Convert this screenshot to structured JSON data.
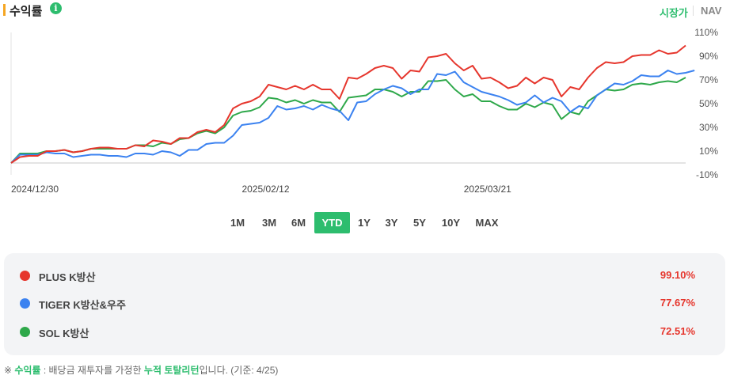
{
  "header": {
    "title": "수익률",
    "info_glyph": "i",
    "toggle_price": "시장가",
    "toggle_nav": "NAV"
  },
  "periods": [
    "1M",
    "3M",
    "6M",
    "YTD",
    "1Y",
    "3Y",
    "5Y",
    "10Y",
    "MAX"
  ],
  "active_period": "YTD",
  "legend": [
    {
      "name": "PLUS K방산",
      "value": "99.10%",
      "color": "#e6362d"
    },
    {
      "name": "TIGER K방산&우주",
      "value": "77.67%",
      "color": "#3b82f0"
    },
    {
      "name": "SOL K방산",
      "value": "72.51%",
      "color": "#2ea84a"
    }
  ],
  "footnote": {
    "prefix": "※ ",
    "term": "수익률",
    "mid": " : 배당금 재투자를 가정한 ",
    "emph": "누적 토탈리턴",
    "suffix": "입니다. (기준: 4/25)"
  },
  "colors": {
    "accent": "#2dbd6e",
    "title_bar": "#f5a623",
    "value_red": "#e6362d"
  },
  "chart_data": {
    "type": "line",
    "x_tick_labels": [
      "2024/12/30",
      "2025/02/12",
      "2025/03/21"
    ],
    "y_tick_labels": [
      "110%",
      "90%",
      "70%",
      "50%",
      "30%",
      "10%",
      "-10%"
    ],
    "ylim": [
      -10,
      110
    ],
    "grid": false,
    "legend_position": "bottom",
    "series": [
      {
        "name": "PLUS K방산",
        "color": "#e6362d",
        "values": [
          0,
          5,
          6,
          6,
          10,
          10,
          11,
          9,
          10,
          12,
          13,
          13,
          12,
          12,
          15,
          14,
          19,
          18,
          16,
          21,
          21,
          26,
          28,
          26,
          32,
          46,
          50,
          52,
          56,
          66,
          64,
          62,
          65,
          62,
          66,
          62,
          62,
          54,
          72,
          71,
          75,
          80,
          82,
          80,
          71,
          78,
          77,
          89,
          90,
          92,
          84,
          78,
          82,
          71,
          72,
          68,
          63,
          65,
          72,
          67,
          72,
          70,
          56,
          64,
          62,
          72,
          80,
          85,
          84,
          85,
          90,
          91,
          91,
          95,
          92,
          93,
          99
        ]
      },
      {
        "name": "TIGER K방산&우주",
        "color": "#3b82f0",
        "values": [
          0,
          7,
          7,
          7,
          9,
          8,
          8,
          5,
          6,
          7,
          7,
          6,
          6,
          5,
          8,
          8,
          7,
          10,
          9,
          6,
          11,
          11,
          16,
          17,
          17,
          23,
          32,
          33,
          34,
          38,
          48,
          45,
          46,
          48,
          45,
          49,
          46,
          44,
          36,
          51,
          52,
          58,
          62,
          65,
          63,
          58,
          62,
          62,
          75,
          74,
          77,
          68,
          64,
          60,
          58,
          56,
          53,
          49,
          51,
          57,
          51,
          55,
          52,
          43,
          48,
          46,
          57,
          62,
          67,
          66,
          69,
          74,
          73,
          73,
          78,
          75,
          76,
          78
        ]
      },
      {
        "name": "SOL K방산",
        "color": "#2ea84a",
        "values": [
          0,
          8,
          8,
          8,
          10,
          10,
          11,
          9,
          10,
          12,
          12,
          12,
          12,
          12,
          15,
          15,
          14,
          17,
          16,
          20,
          21,
          25,
          27,
          25,
          30,
          40,
          43,
          44,
          47,
          55,
          54,
          51,
          53,
          50,
          53,
          51,
          51,
          43,
          55,
          56,
          57,
          62,
          62,
          60,
          56,
          60,
          60,
          69,
          69,
          70,
          62,
          56,
          58,
          52,
          52,
          48,
          45,
          45,
          50,
          47,
          51,
          49,
          37,
          43,
          41,
          52,
          57,
          62,
          61,
          62,
          66,
          67,
          66,
          68,
          69,
          68,
          72
        ]
      }
    ]
  }
}
